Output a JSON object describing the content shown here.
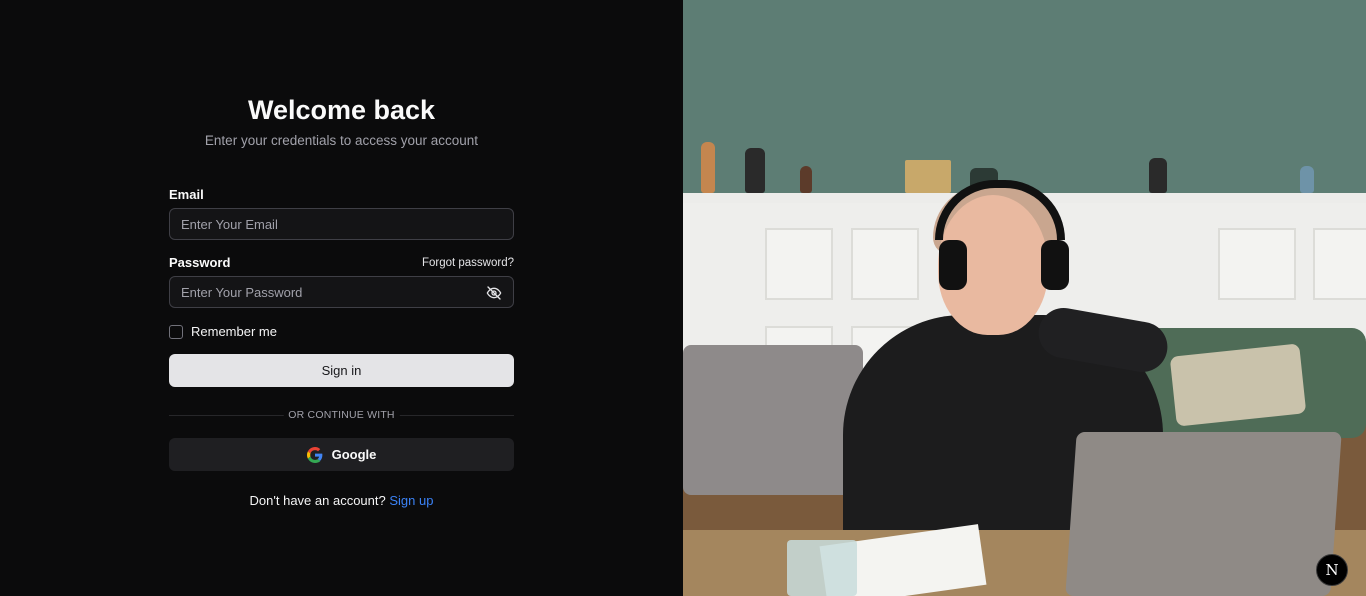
{
  "login": {
    "title": "Welcome back",
    "subtitle": "Enter your credentials to access your account",
    "email_label": "Email",
    "email_placeholder": "Enter Your Email",
    "password_label": "Password",
    "forgot_password": "Forgot password?",
    "password_placeholder": "Enter Your Password",
    "remember_label": "Remember me",
    "signin_label": "Sign in",
    "divider_text": "OR CONTINUE WITH",
    "google_label": "Google",
    "signup_prompt": "Don't have an account?",
    "signup_link": "Sign up"
  },
  "badge": {
    "letter": "N"
  },
  "colors": {
    "accent_link": "#3b82f6",
    "background": "#0b0b0c"
  },
  "icons": [
    "eye-off-icon",
    "google-icon"
  ]
}
